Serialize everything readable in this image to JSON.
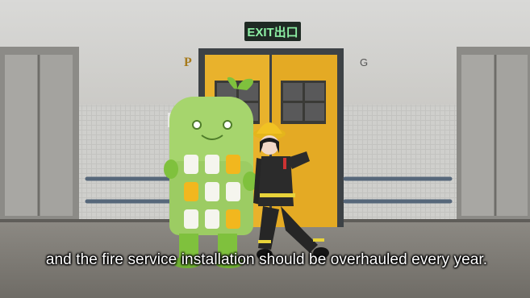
{
  "video": {
    "exit_sign": "EXIT出口",
    "floor_letter_left": "P",
    "floor_letter_right": "G",
    "subtitle": "and the fire service installation should be overhauled every year."
  }
}
